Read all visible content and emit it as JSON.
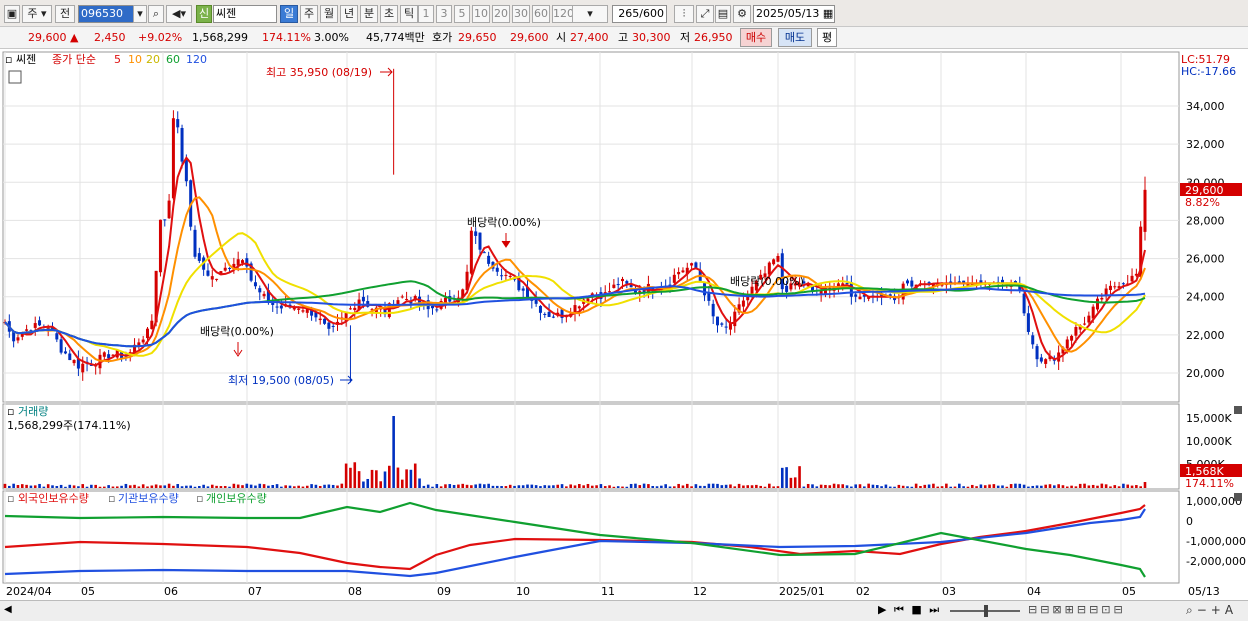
{
  "toolbar": {
    "market_label": "주",
    "prev_label": "전",
    "code": "096530",
    "credit_badge": "신",
    "stock_name": "씨젠",
    "periods": [
      "일",
      "주",
      "월",
      "년",
      "분",
      "초",
      "틱"
    ],
    "active_period": "일",
    "minute_options": [
      "1",
      "3",
      "5",
      "10",
      "20",
      "30",
      "60",
      "120"
    ],
    "count_current": "265",
    "count_total": "/600",
    "date": "2025/05/13"
  },
  "quote": {
    "price": "29,600",
    "change": "2,450",
    "change_pct": "+9.02%",
    "volume": "1,568,299",
    "vol_ratio": "174.11%",
    "pct3": "3.00%",
    "amount": "45,774백만",
    "bid_label": "호가",
    "ask": "29,650",
    "bid": "29,600",
    "open_label": "시",
    "open": "27,400",
    "high_label": "고",
    "high": "30,300",
    "low_label": "저",
    "low": "26,950",
    "buy_label": "매수",
    "sell_label": "매도",
    "eval_label": "평"
  },
  "price_panel": {
    "name_tag": "씨젠",
    "ma_title": "종가 단순",
    "ma_periods": [
      "5",
      "10",
      "20",
      "60",
      "120"
    ],
    "lc_label": "LC:51.79",
    "hc_label": "HC:-17.66",
    "y_ticks": [
      "34,000",
      "32,000",
      "30,000",
      "28,000",
      "26,000",
      "24,000",
      "22,000",
      "20,000"
    ],
    "current_price_tag": "29,600",
    "current_pct_tag": "8.82%",
    "high_annotation": "최고 35,950 (08/19)",
    "low_annotation": "최저 19,500 (08/05)",
    "dividend_labels": [
      "배당락(0.00%)",
      "배당락(0.00%)",
      "배당락(0.00%)"
    ]
  },
  "volume_panel": {
    "title": "거래량",
    "value": "1,568,299주(174.11%)",
    "y_ticks": [
      "15,000K",
      "10,000K",
      "5,000K"
    ],
    "current_tag": "1,568K",
    "pct_tag": "174.11%"
  },
  "holding_panel": {
    "series": [
      "외국인보유수량",
      "기관보유수량",
      "개인보유수량"
    ],
    "y_ticks": [
      "1,000,000",
      "0",
      "-1,000,000",
      "-2,000,000"
    ]
  },
  "x_axis": {
    "labels": [
      "2024/04",
      "05",
      "06",
      "07",
      "08",
      "09",
      "10",
      "11",
      "12",
      "2025/01",
      "02",
      "03",
      "04",
      "05"
    ],
    "end_label": "05/13"
  },
  "colors": {
    "ma5": "#e01010",
    "ma10": "#ff9000",
    "ma20": "#f0e000",
    "ma60": "#10a030",
    "ma120": "#2050e0",
    "up": "#d40000",
    "down": "#0030c0",
    "foreign": "#e01010",
    "institution": "#2050e0",
    "individual": "#10a030"
  }
}
